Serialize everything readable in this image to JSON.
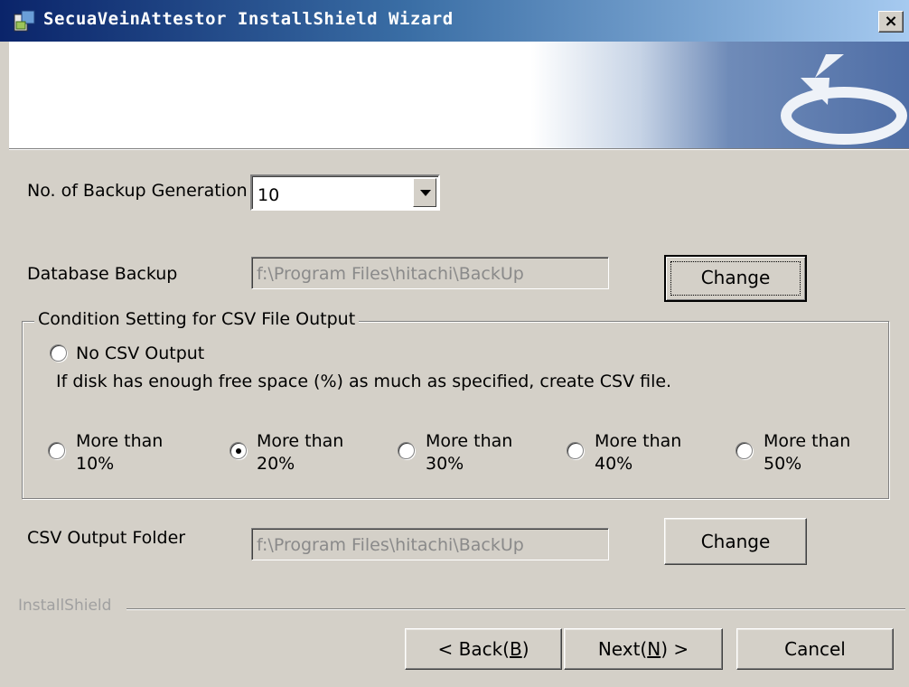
{
  "window": {
    "title": "SecuaVeinAttestor InstallShield Wizard",
    "close_label": "×"
  },
  "backup_generation": {
    "label": "No. of Backup Generation",
    "selected": "10"
  },
  "database_backup": {
    "label": "Database Backup",
    "path": "f:\\Program Files\\hitachi\\BackUp",
    "button_label": "Change"
  },
  "csv_group": {
    "title": "Condition Setting for CSV File Output",
    "no_csv_label": "No CSV Output",
    "description": "If disk has enough free space (%) as much as specified, create CSV file.",
    "options": [
      {
        "line1": "More than",
        "line2": "10%",
        "checked": false
      },
      {
        "line1": "More than",
        "line2": "20%",
        "checked": true
      },
      {
        "line1": "More than",
        "line2": "30%",
        "checked": false
      },
      {
        "line1": "More than",
        "line2": "40%",
        "checked": false
      },
      {
        "line1": "More than",
        "line2": "50%",
        "checked": false
      }
    ]
  },
  "csv_folder": {
    "label": "CSV Output Folder",
    "path": "f:\\Program Files\\hitachi\\BackUp",
    "button_label": "Change"
  },
  "footer": {
    "brand": "InstallShield",
    "back": {
      "pre": "< Back(",
      "key": "B",
      "post": ")"
    },
    "next": {
      "pre": "Next(",
      "key": "N",
      "post": ") >"
    },
    "cancel": "Cancel"
  }
}
